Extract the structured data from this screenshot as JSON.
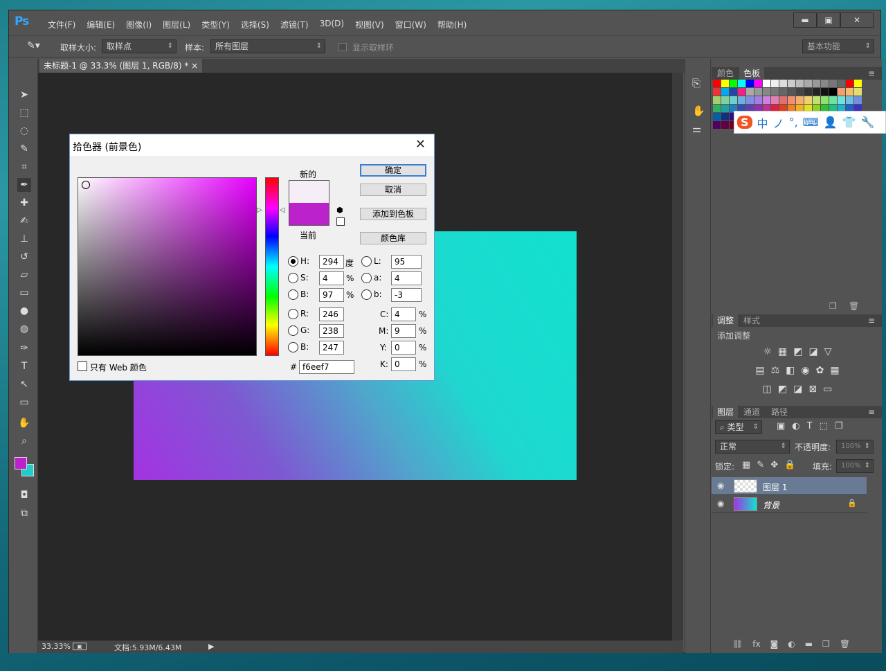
{
  "app": {
    "logo": "Ps",
    "menu": [
      "文件(F)",
      "编辑(E)",
      "图像(I)",
      "图层(L)",
      "类型(Y)",
      "选择(S)",
      "滤镜(T)",
      "3D(D)",
      "视图(V)",
      "窗口(W)",
      "帮助(H)"
    ]
  },
  "options": {
    "sample_size_label": "取样大小:",
    "sample_size_value": "取样点",
    "sample_label": "样本:",
    "sample_value": "所有图层",
    "show_ring": "显示取样环",
    "workspace": "基本功能"
  },
  "document": {
    "tab": "未标题-1 @ 33.3% (图层 1, RGB/8) *",
    "zoom": "33.33%",
    "doc_info": "文档:5.93M/6.43M"
  },
  "gradient": {
    "start": "#a333e3",
    "end": "#12e1cf"
  },
  "panels": {
    "color_tabs": [
      "颜色",
      "色板"
    ],
    "adjust_tabs": [
      "调整",
      "样式"
    ],
    "add_adjustment": "添加调整",
    "layer_tabs": [
      "图层",
      "通道",
      "路径"
    ],
    "kind": "类型",
    "blend": "正常",
    "opacity_label": "不透明度:",
    "opacity": "100%",
    "lock_label": "锁定:",
    "fill_label": "填充:",
    "fill": "100%",
    "layers": [
      {
        "name": "图层 1"
      },
      {
        "name": "背景"
      }
    ]
  },
  "picker": {
    "title": "拾色器 (前景色)",
    "new_label": "新的",
    "current_label": "当前",
    "new_color": "#f6eef7",
    "current_color": "#bb22cc",
    "buttons": {
      "ok": "确定",
      "cancel": "取消",
      "add": "添加到色板",
      "lib": "颜色库"
    },
    "hsb": {
      "H": "294",
      "S": "4",
      "B": "97"
    },
    "rgb": {
      "R": "246",
      "G": "238",
      "B": "247"
    },
    "lab": {
      "L": "95",
      "a": "4",
      "b": "-3"
    },
    "cmyk": {
      "C": "4",
      "M": "9",
      "Y": "0",
      "K": "0"
    },
    "hex": "f6eef7",
    "units": {
      "deg": "度",
      "pct": "%"
    },
    "web_only": "只有 Web 颜色",
    "hex_label": "#",
    "labels": {
      "H": "H:",
      "S": "S:",
      "B": "B:",
      "R": "R:",
      "G": "G:",
      "B2": "B:",
      "L": "L:",
      "a": "a:",
      "b": "b:",
      "C": "C:",
      "M": "M:",
      "Y": "Y:",
      "K": "K:"
    },
    "hue": 294
  },
  "ime": {
    "items": [
      "中",
      "ノ",
      "°,",
      "⌨",
      "👤",
      "👕",
      "🔧"
    ]
  },
  "colors": {
    "foreground": "#bb22cc",
    "background": "#22ccc8",
    "accent": "#31a8ff"
  }
}
